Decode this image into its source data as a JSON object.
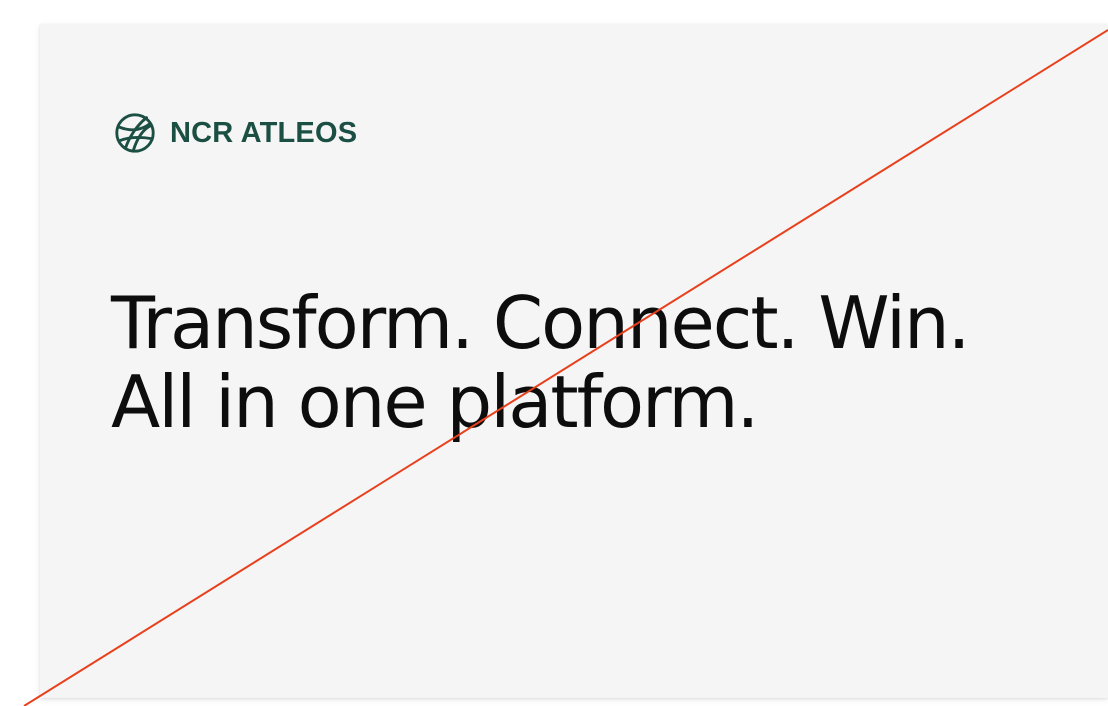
{
  "brand": {
    "name": "NCR ATLEOS",
    "color": "#1c4f43",
    "icon": "globe-logo-icon"
  },
  "headline": {
    "line1": "Transform. Connect. Win.",
    "line2": "All in one platform."
  },
  "colors": {
    "card_background": "#f5f5f5",
    "text": "#0d0d0d",
    "strike_line": "#e8401c"
  }
}
